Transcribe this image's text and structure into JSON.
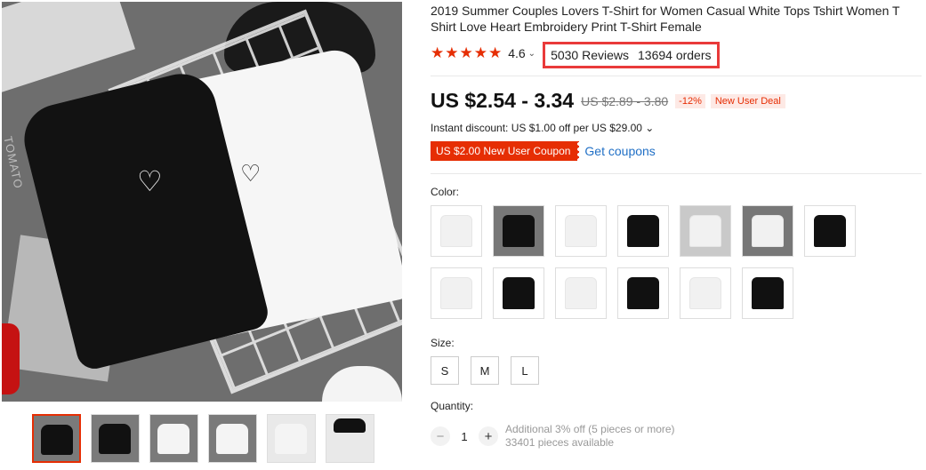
{
  "product": {
    "title": "2019 Summer Couples Lovers T-Shirt for Women Casual White Tops Tshirt Women T Shirt Love Heart Embroidery Print T-Shirt Female",
    "stars": "★★★★★",
    "rating": "4.6",
    "rating_chevron": "⌄",
    "reviews": "5030 Reviews",
    "orders": "13694 orders",
    "price": "US $2.54 - 3.34",
    "original_price": "US $2.89 - 3.80",
    "discount_pct": "-12%",
    "deal_badge": "New User Deal",
    "instant_discount": "Instant discount: US $1.00 off per US $29.00 ⌄",
    "coupon": "US $2.00 New User Coupon",
    "get_coupons": "Get coupons",
    "color_label": "Color:",
    "size_label": "Size:",
    "sizes": [
      "S",
      "M",
      "L"
    ],
    "quantity_label": "Quantity:",
    "quantity_value": "1",
    "quantity_minus": "−",
    "quantity_plus": "+",
    "quantity_note_1": "Additional 3% off (5 pieces or more)",
    "quantity_note_2": "33401 pieces available"
  },
  "main_image_text": "TOMATO",
  "colors": {
    "accent": "#e62e04",
    "link": "#2170c6",
    "highlight_box": "#e93a3a"
  },
  "icons": {
    "heart": "♡",
    "minus": "−",
    "plus": "+"
  }
}
